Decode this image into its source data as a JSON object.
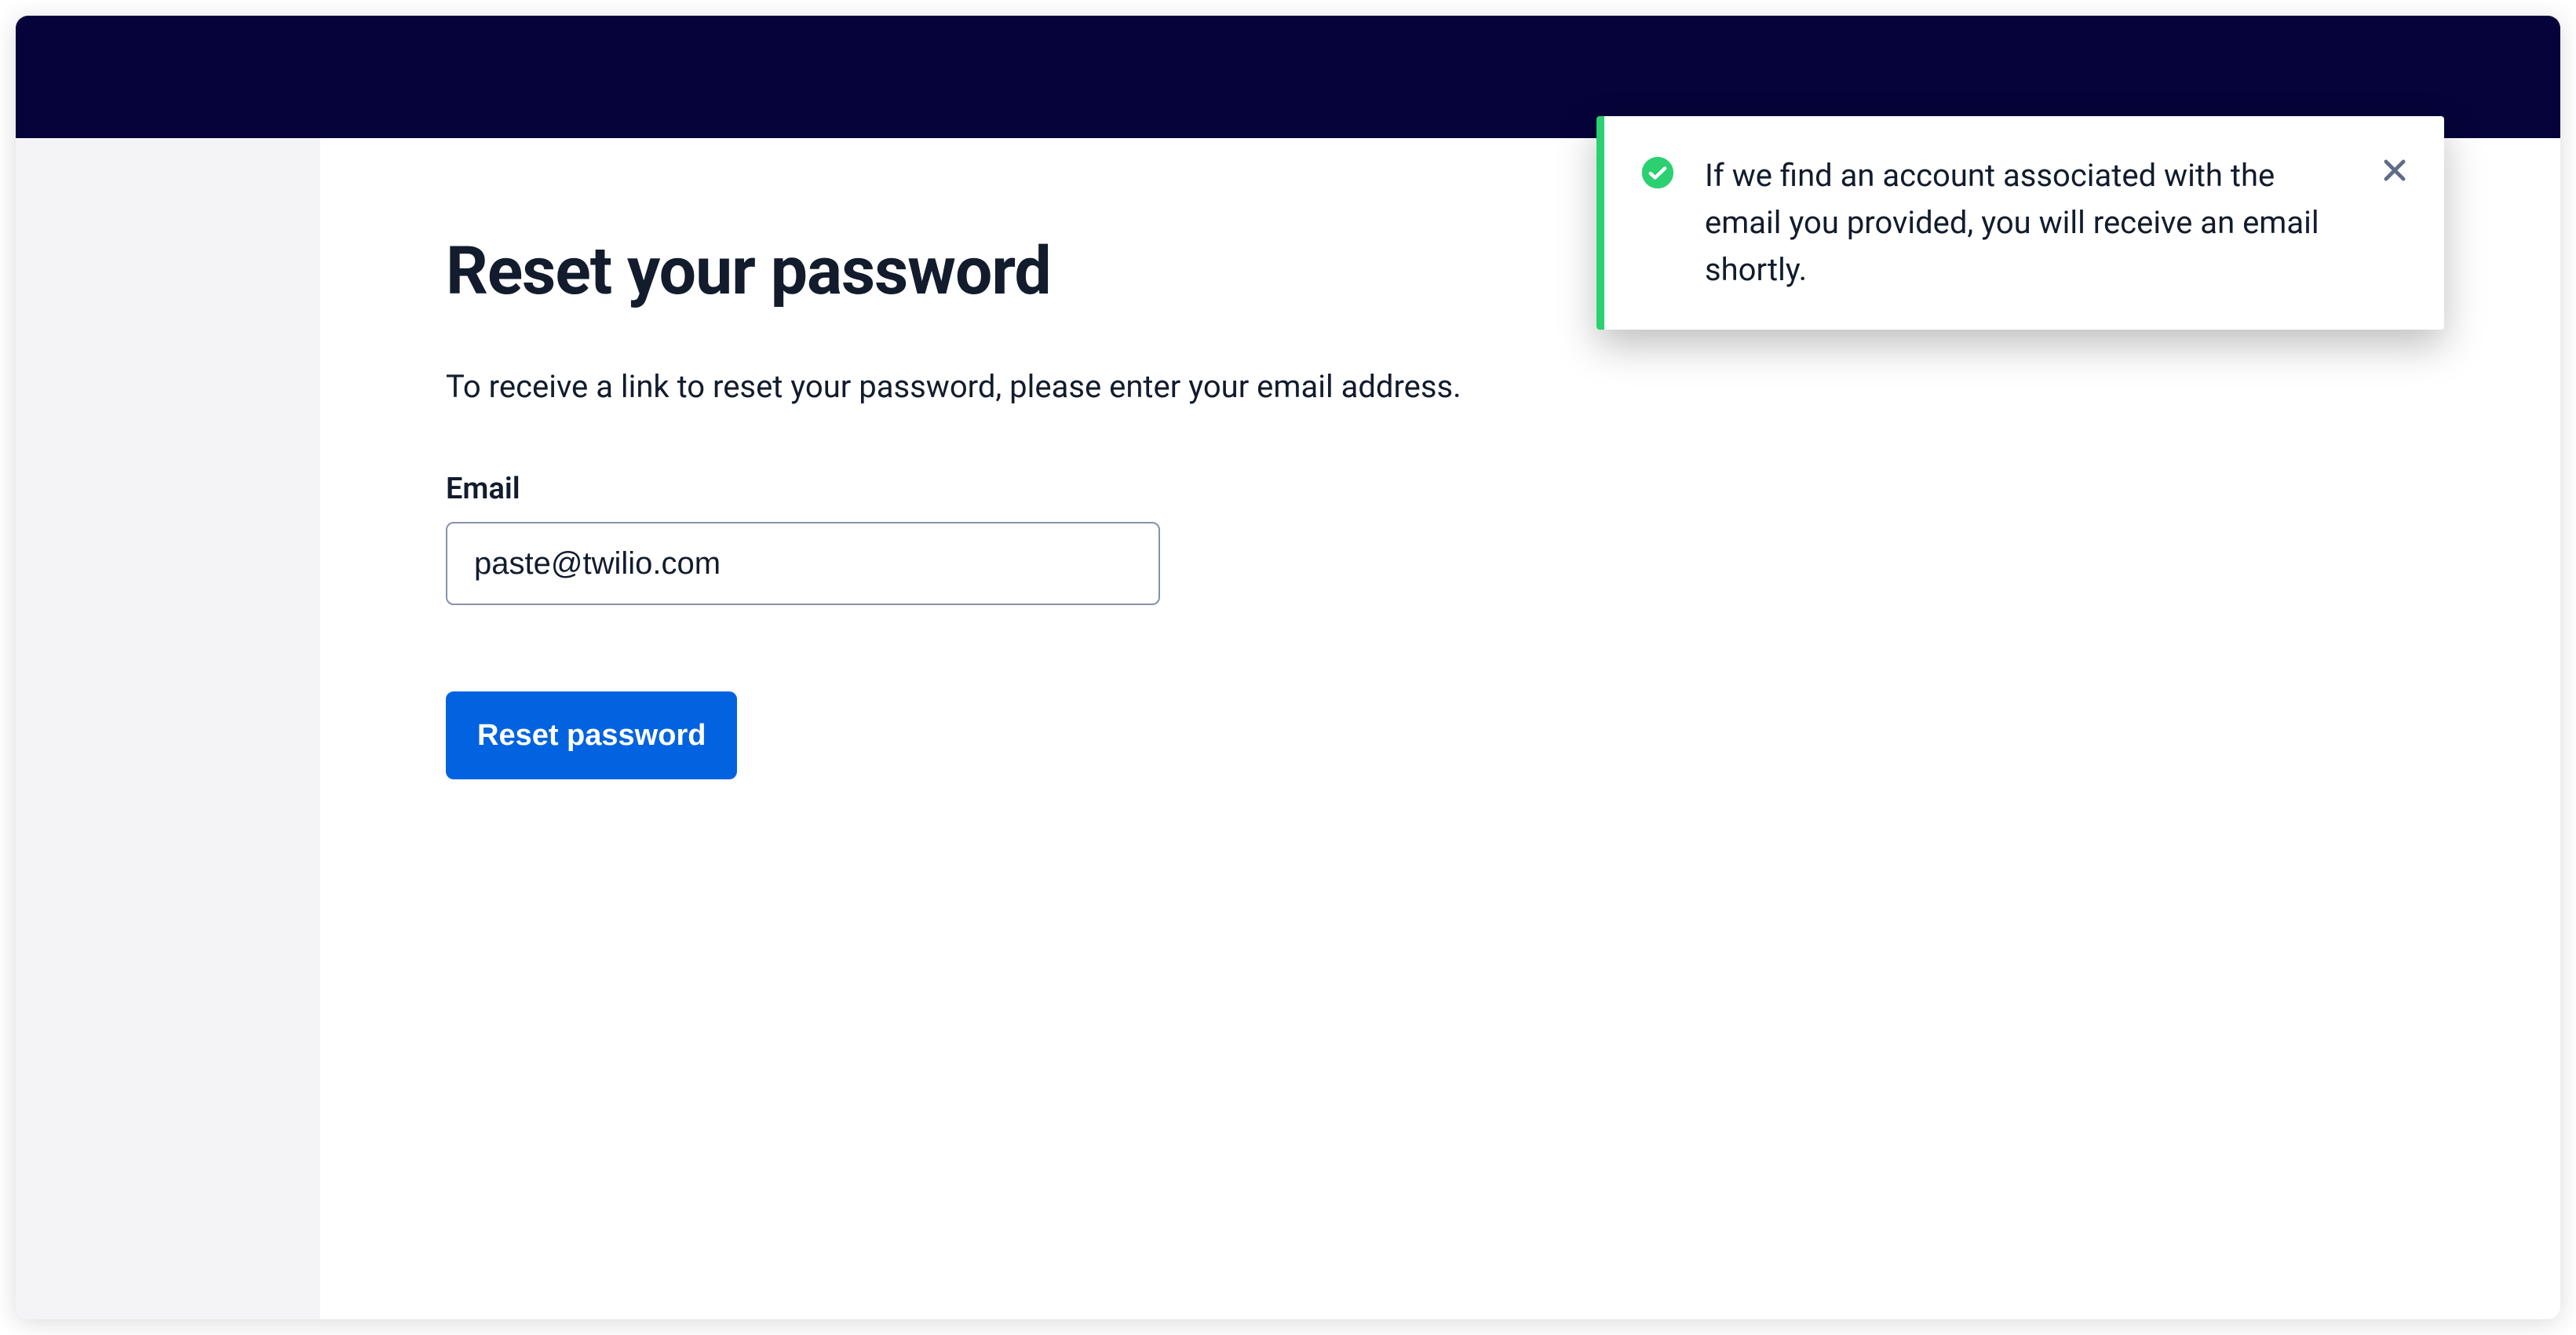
{
  "page": {
    "title": "Reset your password",
    "instruction": "To receive a link to reset your password, please enter your email address."
  },
  "form": {
    "email_label": "Email",
    "email_value": "paste@twilio.com",
    "submit_label": "Reset password"
  },
  "toast": {
    "status": "success",
    "accent_color": "#2bd071",
    "message": "If we find an account associated with the email you provided, you will receive an email shortly."
  }
}
